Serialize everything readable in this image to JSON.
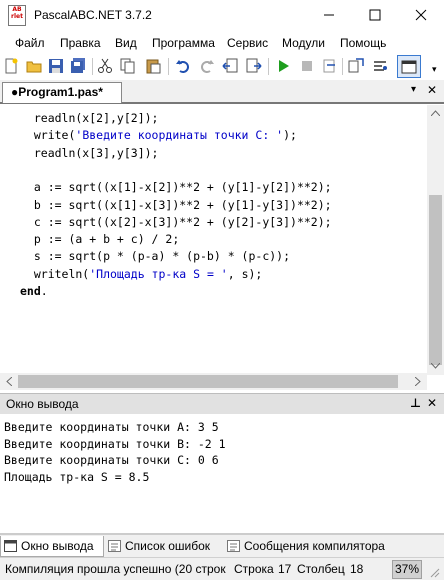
{
  "window": {
    "title": "PascalABC.NET 3.7.2",
    "logo_text": "AB\nrlet",
    "minimize": "—",
    "maximize": "☐",
    "close": "✕"
  },
  "menu": [
    "Файл",
    "Правка",
    "Вид",
    "Программа",
    "Сервис",
    "Модули",
    "Помощь"
  ],
  "toolbar": {
    "icons": [
      "new-file-icon",
      "open-folder-icon",
      "save-icon",
      "save-all-icon",
      "cut-icon",
      "copy-icon",
      "paste-icon",
      "undo-icon",
      "redo-icon",
      "navigate-back-icon",
      "navigate-forward-icon",
      "run-icon",
      "stop-icon",
      "step-over-icon",
      "step-into-icon",
      "debug-icon",
      "output-window-icon"
    ],
    "overflow": "▾"
  },
  "editor_tab": {
    "label": "●Program1.pas*",
    "dropdown": "▾",
    "close": "✕"
  },
  "code": [
    {
      "parts": [
        {
          "t": "  readln(x[2],y[2]);",
          "c": ""
        }
      ]
    },
    {
      "parts": [
        {
          "t": "  write(",
          "c": ""
        },
        {
          "t": "'Введите координаты точки C: '",
          "c": "str"
        },
        {
          "t": ");",
          "c": ""
        }
      ]
    },
    {
      "parts": [
        {
          "t": "  readln(x[3],y[3]);",
          "c": ""
        }
      ]
    },
    {
      "parts": [
        {
          "t": "",
          "c": ""
        }
      ]
    },
    {
      "parts": [
        {
          "t": "  a := sqrt((x[1]-x[2])**2 + (y[1]-y[2])**2);",
          "c": ""
        }
      ]
    },
    {
      "parts": [
        {
          "t": "  b := sqrt((x[1]-x[3])**2 + (y[1]-y[3])**2);",
          "c": ""
        }
      ]
    },
    {
      "parts": [
        {
          "t": "  c := sqrt((x[2]-x[3])**2 + (y[2]-y[3])**2);",
          "c": ""
        }
      ]
    },
    {
      "parts": [
        {
          "t": "  p := (a + b + c) / 2;",
          "c": ""
        }
      ]
    },
    {
      "parts": [
        {
          "t": "  s := sqrt(p * (p-a) * (p-b) * (p-c));",
          "c": ""
        }
      ]
    },
    {
      "parts": [
        {
          "t": "  writeln(",
          "c": ""
        },
        {
          "t": "'Площадь тр-ка S = '",
          "c": "str"
        },
        {
          "t": ", s);",
          "c": ""
        }
      ]
    },
    {
      "parts": [
        {
          "t": "end",
          "c": "kw"
        },
        {
          "t": ".",
          "c": ""
        }
      ]
    }
  ],
  "output_panel": {
    "title": "Окно вывода",
    "pin": "⊥",
    "close": "✕",
    "lines": [
      "Введите координаты точки A: 3 5",
      "Введите координаты точки B: -2 1",
      "Введите координаты точки C: 0 6",
      "Площадь тр-ка S = 8.5"
    ]
  },
  "bottom_tabs": [
    {
      "label": "Окно вывода",
      "icon": "output-window-icon",
      "active": true
    },
    {
      "label": "Список ошибок",
      "icon": "error-list-icon",
      "active": false
    },
    {
      "label": "Сообщения компилятора",
      "icon": "compiler-messages-icon",
      "active": false
    }
  ],
  "status": {
    "message": "Компиляция прошла успешно (20 строк",
    "line_label": "Строка",
    "line_value": "17",
    "col_label": "Столбец",
    "col_value": "18",
    "zoom": "37%"
  },
  "colors": {
    "string": "#0000c8",
    "tab_underline": "#777777",
    "run_green": "#1e9e1e"
  }
}
